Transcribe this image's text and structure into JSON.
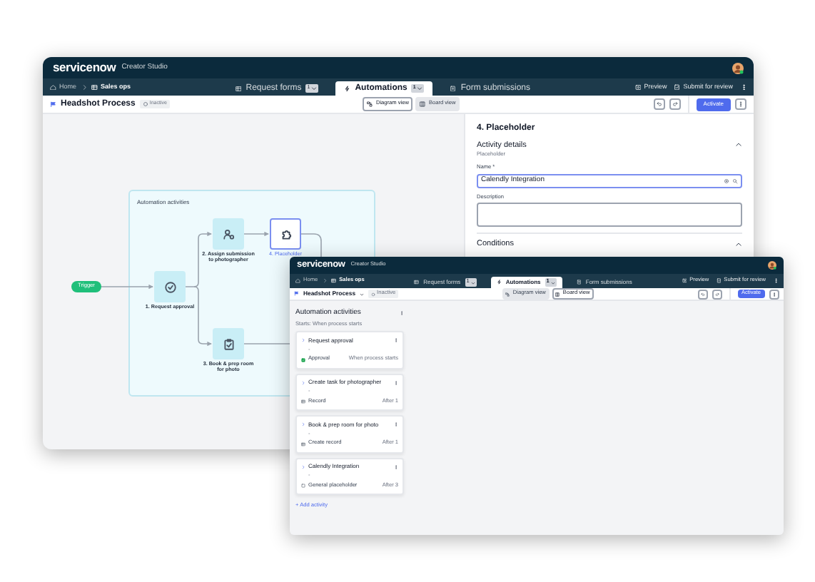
{
  "main_window": {
    "header": {
      "logo": "servicenow",
      "product": "Creator Studio"
    },
    "breadcrumbs": [
      {
        "label": "Home"
      },
      {
        "label": "Sales ops"
      }
    ],
    "tabs": [
      {
        "label": "Request forms",
        "count": "1",
        "selected": false
      },
      {
        "label": "Automations",
        "count": "1",
        "selected": true
      },
      {
        "label": "Form submissions",
        "selected": false
      }
    ],
    "actions": [
      "Preview",
      "Submit for review"
    ],
    "toolbar": {
      "title": "Headshot Process",
      "status": "Inactive",
      "views": [
        {
          "label": "Diagram view",
          "selected": true
        },
        {
          "label": "Board view",
          "selected": false
        }
      ],
      "primary": "Activate"
    },
    "diagram": {
      "title": "Automation activities",
      "trigger": "Trigger",
      "nodes": [
        {
          "label": "1. Request approval",
          "selected": false
        },
        {
          "label": "2. Assign submission to photographer",
          "selected": false
        },
        {
          "label": "3. Book & prep room for photo",
          "selected": false
        },
        {
          "label": "4. Placeholder",
          "selected": true
        }
      ]
    },
    "panel": {
      "title": "4. Placeholder",
      "section": "Activity details",
      "subtitle": "Placeholder",
      "name_label": "Name *",
      "name_value": "Calendly Integration",
      "description_label": "Description",
      "conditions": "Conditions"
    }
  },
  "front_window": {
    "header": {
      "logo": "servicenow",
      "product": "Creator Studio"
    },
    "breadcrumbs": [
      {
        "label": "Home"
      },
      {
        "label": "Sales ops"
      }
    ],
    "tabs": [
      {
        "label": "Request forms",
        "count": "1",
        "selected": false
      },
      {
        "label": "Automations",
        "count": "1",
        "selected": true
      },
      {
        "label": "Form submissions",
        "selected": false
      }
    ],
    "actions": [
      "Preview",
      "Submit for review"
    ],
    "toolbar": {
      "title": "Headshot Process",
      "status": "Inactive",
      "views": [
        {
          "label": "Diagram view",
          "selected": false
        },
        {
          "label": "Board view",
          "selected": true
        }
      ],
      "primary": "Activate"
    },
    "board": {
      "title": "Automation activities",
      "subtitle": "Starts: When process starts",
      "cards": [
        {
          "title": "Request approval",
          "detail": "-",
          "type": "Approval",
          "timing": "When process starts"
        },
        {
          "title": "Create task for photographer",
          "detail": "-",
          "type": "Record",
          "timing": "After 1"
        },
        {
          "title": "Book & prep room for photo",
          "detail": "-",
          "type": "Create record",
          "timing": "After 1"
        },
        {
          "title": "Calendly Integration",
          "detail": "-",
          "type": "General placeholder",
          "timing": "After 3"
        }
      ],
      "add": "+ Add activity"
    }
  }
}
